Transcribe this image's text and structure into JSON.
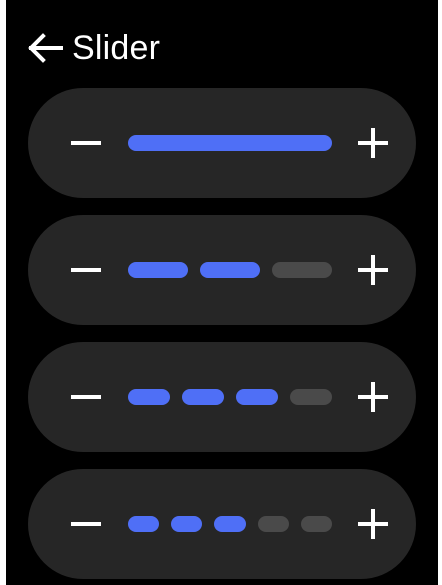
{
  "header": {
    "title": "Slider",
    "back_icon": "arrow-left-icon"
  },
  "colors": {
    "background": "#000000",
    "card": "#262626",
    "active": "#4f6ff6",
    "inactive": "#4a4a4a",
    "foreground": "#ffffff"
  },
  "sliders": [
    {
      "segments": 1,
      "active": 1,
      "value": 1.0,
      "decrease_icon": "minus-icon",
      "increase_icon": "plus-icon"
    },
    {
      "segments": 3,
      "active": 2,
      "value": 0.667,
      "decrease_icon": "minus-icon",
      "increase_icon": "plus-icon"
    },
    {
      "segments": 4,
      "active": 3,
      "value": 0.75,
      "decrease_icon": "minus-icon",
      "increase_icon": "plus-icon"
    },
    {
      "segments": 5,
      "active": 3,
      "value": 0.6,
      "decrease_icon": "minus-icon",
      "increase_icon": "plus-icon"
    }
  ]
}
